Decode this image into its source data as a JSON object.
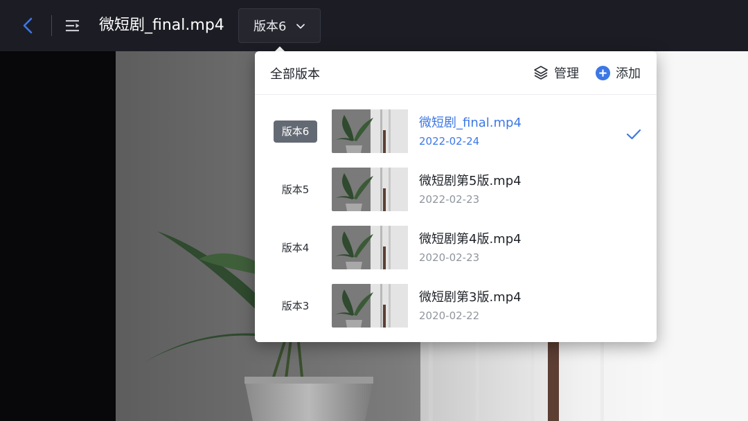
{
  "header": {
    "file_title": "微短剧_final.mp4",
    "selected_version": "版本6"
  },
  "dropdown": {
    "title": "全部版本",
    "manage_label": "管理",
    "add_label": "添加",
    "versions": [
      {
        "tag": "版本6",
        "file_name": "微短剧_final.mp4",
        "date": "2022-02-24",
        "selected": true
      },
      {
        "tag": "版本5",
        "file_name": "微短剧第5版.mp4",
        "date": "2022-02-23",
        "selected": false
      },
      {
        "tag": "版本4",
        "file_name": "微短剧第4版.mp4",
        "date": "2020-02-23",
        "selected": false
      },
      {
        "tag": "版本3",
        "file_name": "微短剧第3版.mp4",
        "date": "2020-02-22",
        "selected": false
      }
    ]
  },
  "colors": {
    "accent": "#3c77e6",
    "topbar_bg": "#1c1d24",
    "active_tag_bg": "#646a73"
  },
  "icons": [
    "back-arrow-icon",
    "episode-list-icon",
    "chevron-down-icon",
    "layers-icon",
    "plus-circle-icon",
    "check-icon"
  ]
}
